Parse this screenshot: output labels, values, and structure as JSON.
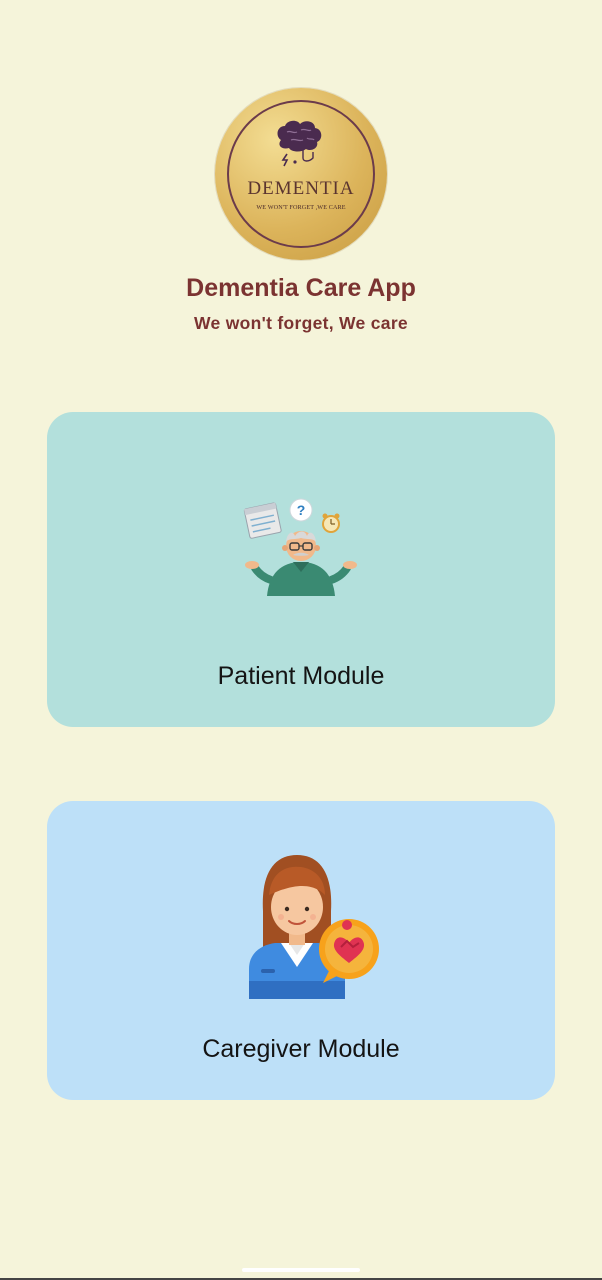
{
  "logo": {
    "name": "DEMENTIA",
    "tagline": "WE WON'T FORGET ,WE CARE",
    "icon": "brain-icon"
  },
  "header": {
    "title": "Dementia Care App",
    "subtitle": "We won't forget, We care"
  },
  "modules": {
    "patient": {
      "label": "Patient Module",
      "icon": "confused-elderly-man-icon",
      "background": "#b3e0dc"
    },
    "caregiver": {
      "label": "Caregiver Module",
      "icon": "caregiver-woman-heart-icon",
      "background": "#bde0f8"
    }
  },
  "colors": {
    "page_background": "#f5f4da",
    "title": "#7b3331"
  }
}
